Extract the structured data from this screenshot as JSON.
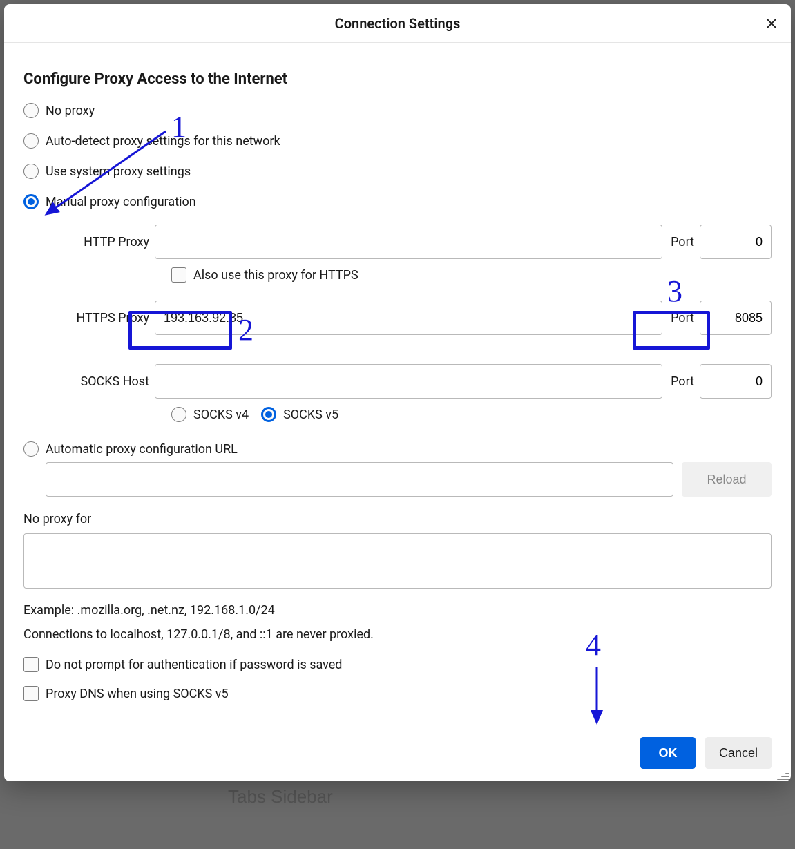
{
  "dialog": {
    "title": "Connection Settings",
    "section_heading": "Configure Proxy Access to the Internet"
  },
  "radios": {
    "no_proxy": "No proxy",
    "auto_detect": "Auto-detect proxy settings for this network",
    "system": "Use system proxy settings",
    "manual": "Manual proxy configuration",
    "auto_config": "Automatic proxy configuration URL",
    "selected": "manual"
  },
  "http": {
    "label": "HTTP Proxy",
    "value": "",
    "port_label": "Port",
    "port": "0"
  },
  "also_https": {
    "label": "Also use this proxy for HTTPS",
    "checked": false
  },
  "https": {
    "label": "HTTPS Proxy",
    "value": "193.163.92.35",
    "port_label": "Port",
    "port": "8085"
  },
  "socks": {
    "label": "SOCKS Host",
    "value": "",
    "port_label": "Port",
    "port": "0"
  },
  "socks_version": {
    "v4": "SOCKS v4",
    "v5": "SOCKS v5",
    "selected": "v5"
  },
  "pac": {
    "value": "",
    "reload": "Reload"
  },
  "noproxy": {
    "label": "No proxy for",
    "value": "",
    "example": "Example: .mozilla.org, .net.nz, 192.168.1.0/24",
    "note": "Connections to localhost, 127.0.0.1/8, and ::1 are never proxied."
  },
  "opts": {
    "no_prompt": "Do not prompt for authentication if password is saved",
    "proxy_dns": "Proxy DNS when using SOCKS v5"
  },
  "buttons": {
    "ok": "OK",
    "cancel": "Cancel"
  },
  "annotations": {
    "n1": "1",
    "n2": "2",
    "n3": "3",
    "n4": "4"
  },
  "background_text": "Tabs Sidebar"
}
